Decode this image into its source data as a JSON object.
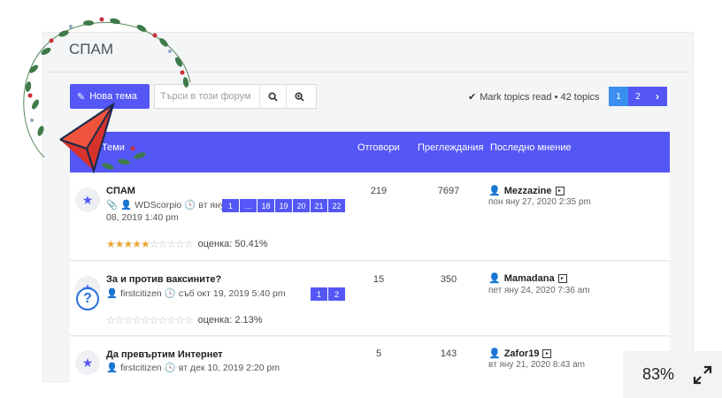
{
  "forum": {
    "title": "СПАМ"
  },
  "toolbar": {
    "new_topic_label": "Нова тема",
    "search_placeholder": "Търси в този форум",
    "mark_read_label": "Mark topics read • 42 topics",
    "pages": [
      "1",
      "2"
    ],
    "active_page": "1"
  },
  "header": {
    "topics": "Теми",
    "replies": "Отговори",
    "views": "Преглеждания",
    "last_post": "Последно мнение"
  },
  "topics": [
    {
      "title": "СПАМ",
      "author": "WDScorpio",
      "date_part1": "вт яну",
      "date_part2": "08, 2019 1:40 pm",
      "pages": [
        "1",
        "...",
        "18",
        "19",
        "20",
        "21",
        "22"
      ],
      "rating": 5,
      "rating_label": "оценка: 50.41%",
      "replies": "219",
      "views": "7697",
      "last_user": "Mezzazine",
      "last_date": "пон яну 27, 2020 2:35 pm"
    },
    {
      "title": "За и против ваксините?",
      "author": "firstcitizen",
      "date": "съб окт 19, 2019 5:40 pm",
      "pages": [
        "1",
        "2"
      ],
      "rating": 0,
      "rating_label": "оценка: 2.13%",
      "replies": "15",
      "views": "350",
      "last_user": "Mamadana",
      "last_date": "пет яну 24, 2020 7:36 am"
    },
    {
      "title": "Да превъртим Интернет",
      "author": "firstcitizen",
      "date": "вт дек 10, 2019 2:20 pm",
      "replies": "5",
      "views": "143",
      "last_user": "Zafor19",
      "last_date": "вт яну 21, 2020 8:43 am"
    }
  ],
  "zoom": {
    "level": "83%"
  },
  "colors": {
    "accent": "#5457f5",
    "active_page": "#3a8ff0",
    "star": "#e7a93a"
  }
}
